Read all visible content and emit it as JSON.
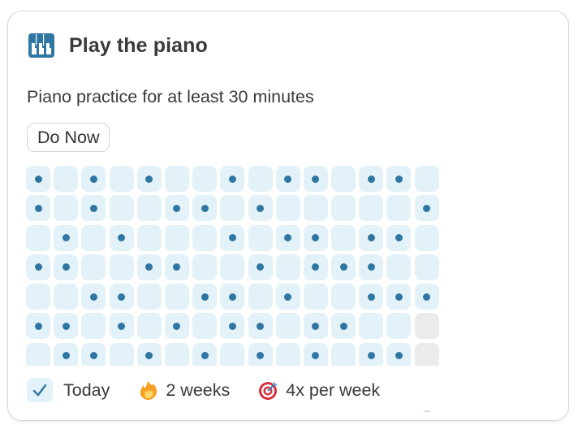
{
  "card": {
    "title": "Play the piano",
    "icon": "piano-icon",
    "description": "Piano practice for at least 30 minutes",
    "do_now_label": "Do Now"
  },
  "colors": {
    "accent": "#2f76a3",
    "cell_bg": "#e3f1f8",
    "future_bg": "#ebebeb"
  },
  "grid": {
    "columns": 15,
    "rows": 7,
    "legend": "1 = done, 0 = not done, F = future",
    "cells": [
      [
        1,
        0,
        1,
        0,
        1,
        0,
        0,
        1,
        0,
        1,
        1,
        0,
        1,
        1,
        0
      ],
      [
        1,
        0,
        1,
        0,
        0,
        1,
        1,
        0,
        1,
        0,
        0,
        0,
        0,
        0,
        1
      ],
      [
        0,
        1,
        0,
        1,
        0,
        0,
        0,
        1,
        0,
        1,
        1,
        0,
        1,
        1,
        0
      ],
      [
        1,
        1,
        0,
        0,
        1,
        1,
        0,
        0,
        1,
        0,
        1,
        1,
        1,
        0,
        0
      ],
      [
        0,
        0,
        1,
        1,
        0,
        0,
        1,
        1,
        0,
        1,
        0,
        0,
        1,
        1,
        1
      ],
      [
        1,
        1,
        0,
        1,
        0,
        1,
        0,
        1,
        1,
        0,
        1,
        1,
        0,
        0,
        "F"
      ],
      [
        0,
        1,
        1,
        0,
        1,
        0,
        1,
        0,
        1,
        0,
        1,
        0,
        1,
        1,
        "F"
      ]
    ]
  },
  "footer": {
    "today": {
      "icon": "checkmark-icon",
      "label": "Today",
      "checked": true
    },
    "streak": {
      "icon": "fire-icon",
      "label": "2 weeks"
    },
    "goal": {
      "icon": "target-icon",
      "label": "4x per week"
    }
  }
}
